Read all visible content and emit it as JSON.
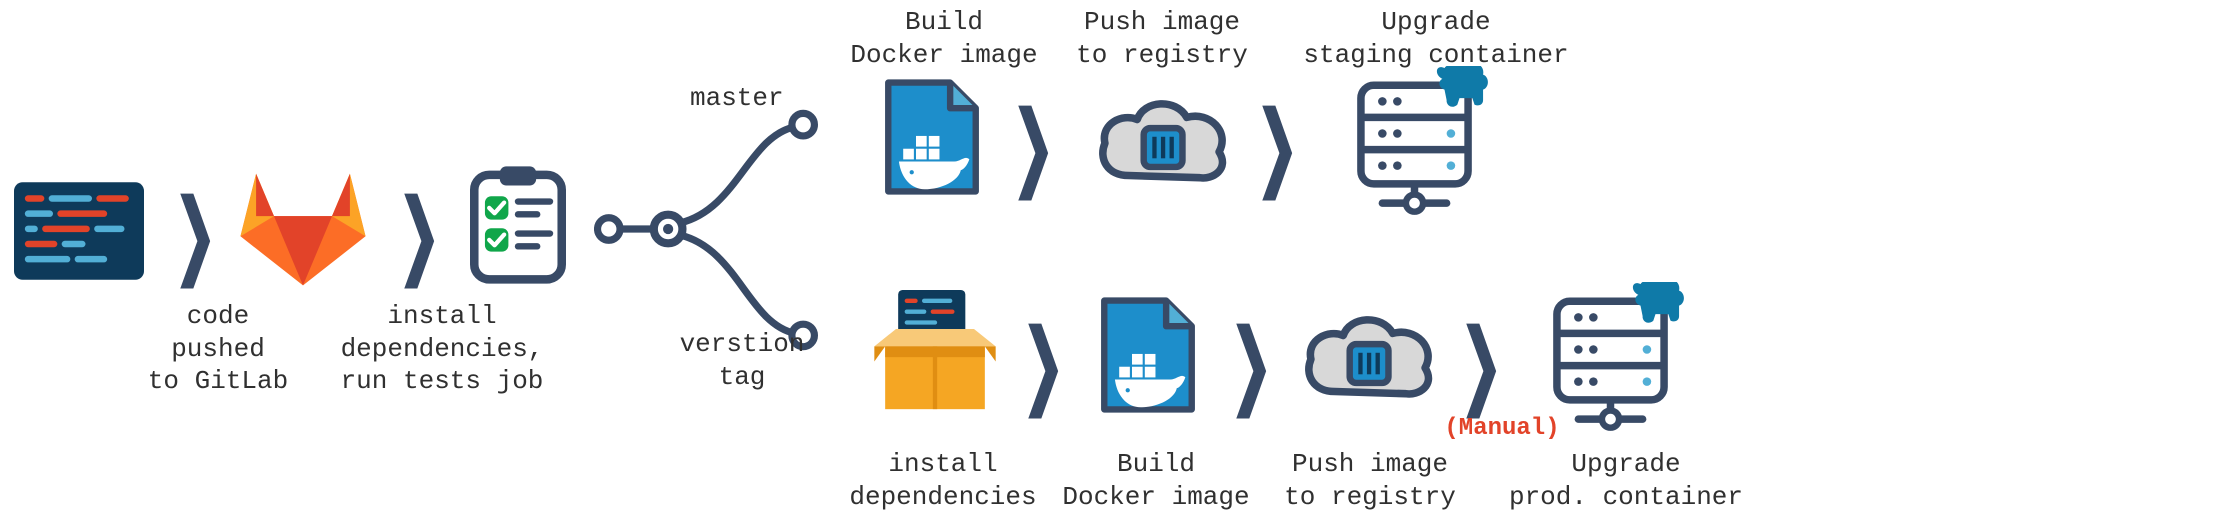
{
  "labels": {
    "code_pushed": "code\npushed\nto GitLab",
    "install_deps_tests": "install\ndependencies,\nrun tests job",
    "branch_master": "master",
    "branch_tag": "verstion\ntag",
    "top_build_docker": "Build\nDocker image",
    "top_push_registry": "Push image\nto registry",
    "top_upgrade_staging": "Upgrade\nstaging container",
    "bot_install_deps": "install\ndependencies",
    "bot_build_docker": "Build\nDocker image",
    "bot_push_registry": "Push image\nto registry",
    "bot_upgrade_prod": "Upgrade\nprod. container",
    "manual": "(Manual)"
  },
  "icons": {
    "code_editor": "code-editor-icon",
    "gitlab": "gitlab-icon",
    "clipboard": "clipboard-check-icon",
    "branch": "git-branch-icon",
    "docker_file": "docker-file-icon",
    "cloud_container": "cloud-container-icon",
    "server_rancher": "server-rancher-icon",
    "package_box": "package-code-icon"
  },
  "colors": {
    "dark": "#384a66",
    "navy": "#0e3a5a",
    "blue": "#1d8ecb",
    "blue_light": "#52afd6",
    "green": "#10a64a",
    "gitlab_orange": "#fc6d26",
    "gitlab_red": "#e24329",
    "gitlab_yellow": "#fca326",
    "box_tan": "#f5a623",
    "box_light": "#f8c978",
    "cloud_fill": "#d8d8d8",
    "red": "#e24329",
    "teal_dark": "#0f7aa8"
  }
}
